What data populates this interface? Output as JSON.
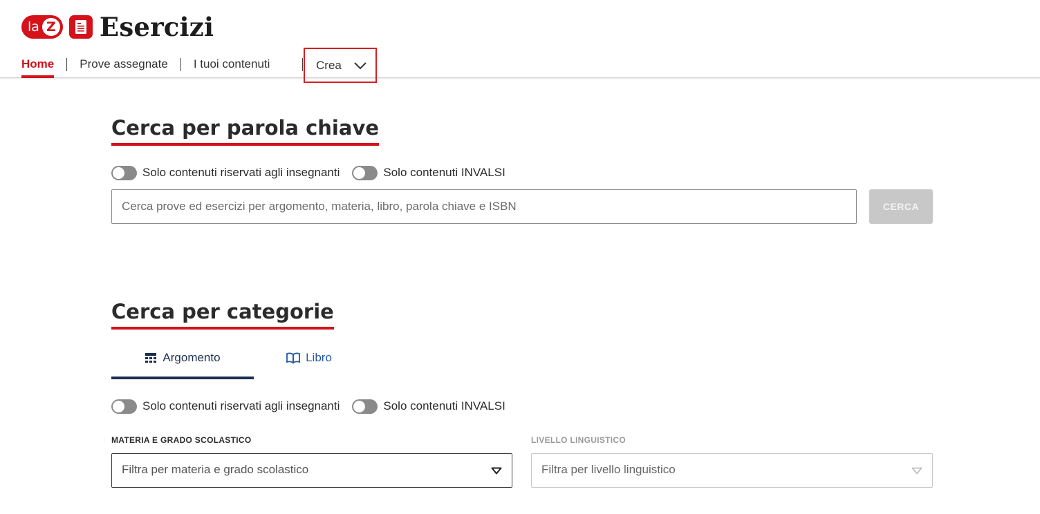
{
  "app": {
    "logo_la": "la",
    "logo_z": "Z",
    "title": "Esercizi",
    "accent_color": "#d5111a"
  },
  "nav": {
    "items": [
      {
        "label": "Home",
        "active": true
      },
      {
        "label": "Prove assegnate",
        "active": false
      },
      {
        "label": "I tuoi contenuti",
        "active": false
      }
    ],
    "crea": {
      "label": "Crea",
      "icon": "chevron-down-icon"
    }
  },
  "keyword_search": {
    "title": "Cerca per parola chiave",
    "toggle_teachers": "Solo contenuti riservati agli insegnanti",
    "toggle_invalsi": "Solo contenuti INVALSI",
    "placeholder": "Cerca prove ed esercizi per argomento, materia, libro, parola chiave e ISBN",
    "button": "CERCA"
  },
  "category_search": {
    "title": "Cerca per categorie",
    "tabs": [
      {
        "label": "Argomento",
        "icon": "topic-tree-icon",
        "active": true
      },
      {
        "label": "Libro",
        "icon": "open-book-icon",
        "active": false
      }
    ],
    "toggle_teachers": "Solo contenuti riservati agli insegnanti",
    "toggle_invalsi": "Solo contenuti INVALSI",
    "subject_label": "MATERIA E GRADO SCOLASTICO",
    "subject_placeholder": "Filtra per materia e grado scolastico",
    "level_label": "LIVELLO LINGUISTICO",
    "level_placeholder": "Filtra per livello linguistico"
  }
}
